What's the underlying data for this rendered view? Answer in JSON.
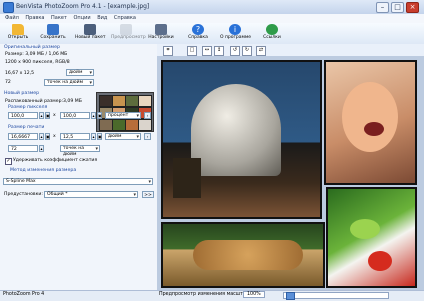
{
  "window": {
    "title": "BenVista PhotoZoom Pro 4.1 - [example.jpg]"
  },
  "menu": [
    "Файл",
    "Правка",
    "Пакет",
    "Опции",
    "Вид",
    "Справка"
  ],
  "toolbar": [
    {
      "label": "Открыть",
      "icon": "folder-icon",
      "color": "#f2b734"
    },
    {
      "label": "Сохранить",
      "icon": "save-icon",
      "color": "#3774c9"
    },
    {
      "label": "Новый пакет",
      "icon": "batch-icon",
      "color": "#4c5f7c"
    },
    {
      "label": "Предпросмотр",
      "icon": "preview-icon",
      "color": "#b9c1cc"
    },
    {
      "label": "Настройки",
      "icon": "tools-icon",
      "color": "#5d6f8c"
    },
    {
      "label": "Справка",
      "icon": "help-icon",
      "color": "#2a72d8"
    },
    {
      "label": "О программе",
      "icon": "info-icon",
      "color": "#2a72d8"
    },
    {
      "label": "Ссылки",
      "icon": "globe-icon",
      "color": "#2f9c4a"
    }
  ],
  "panel": {
    "original_size": {
      "title": "Оригинальный размер",
      "size_text": "Размер: 3,09 МБ / 1,06 МБ",
      "pixels_text": "1200 x 900 пикселя, RGB/8",
      "dims_value": "16,67 x 12,5",
      "dims_unit": "дюйм",
      "dpi_value": "72",
      "dpi_unit": "точек на дюйм"
    },
    "new_size": {
      "title": "Новый размер",
      "unpacked_text": "Распакованный размер:3,09 МБ",
      "pixel_size_title": "Размер пикселя",
      "pixel_w": "100,0",
      "pixel_h": "100,0",
      "pixel_unit": "процент",
      "print_size_title": "Размер печати",
      "print_w": "16,6667",
      "print_h": "12,5",
      "print_unit": "дюйм",
      "print_dpi": "72",
      "print_dpi_unit": "точек на дюйм",
      "times": "x",
      "keep_ratio": "Удерживать коэффициент сжатия",
      "keep_ratio_checked": "✓"
    },
    "method": {
      "title": "Метод изменения размера",
      "value": "S-Spline Max",
      "presets_label": "Предустановки:",
      "presets_value": "Общий *",
      "more_button": ">>"
    }
  },
  "status": {
    "left": "PhotoZoom Pro 4",
    "preview_label": "Предпросмотр изменения масштаба:",
    "zoom": "100%"
  }
}
